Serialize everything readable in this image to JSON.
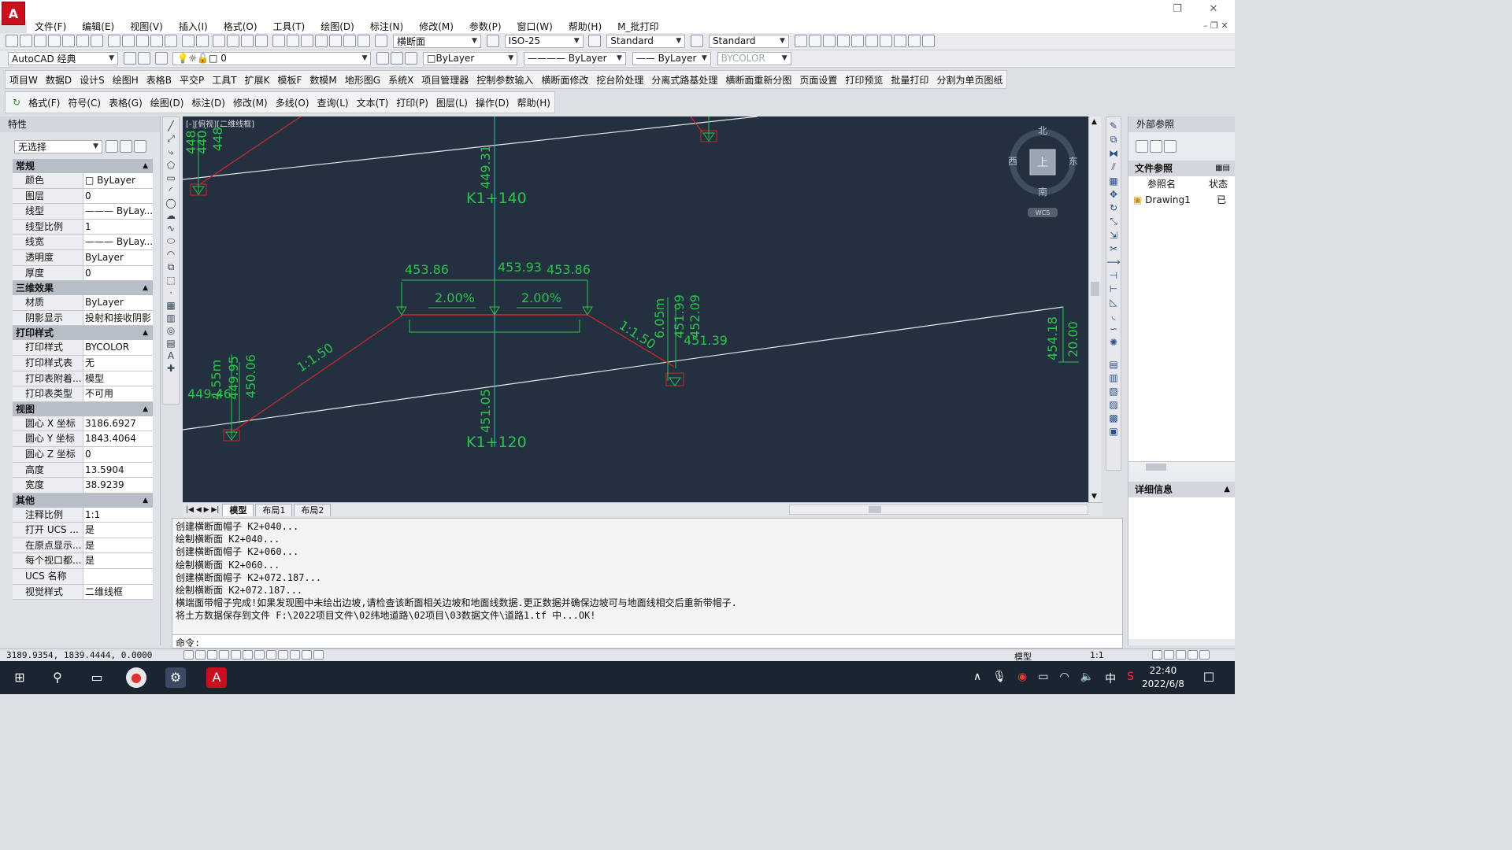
{
  "window": {
    "min_icon": "minimize-icon",
    "restore_icon": "restore-icon",
    "close_icon": "close-icon"
  },
  "menu": [
    "文件(F)",
    "编辑(E)",
    "视图(V)",
    "插入(I)",
    "格式(O)",
    "工具(T)",
    "绘图(D)",
    "标注(N)",
    "修改(M)",
    "参数(P)",
    "窗口(W)",
    "帮助(H)",
    "M_批打印"
  ],
  "toolbar": {
    "text_style": "横断面",
    "dim_style": "ISO-25",
    "table_style": "Standard",
    "multileader_style": "Standard",
    "workspace": "AutoCAD 经典",
    "layer": "0",
    "color": "ByLayer",
    "linetype": "ByLayer",
    "lineweight": "ByLayer",
    "plotstyle": "BYCOLOR"
  },
  "plugin_menu1": [
    "项目W",
    "数据D",
    "设计S",
    "绘图H",
    "表格B",
    "平交P",
    "工具T",
    "扩展K",
    "模板F",
    "数模M",
    "地形图G",
    "系统X",
    "项目管理器",
    "控制参数输入",
    "横断面修改",
    "挖台阶处理",
    "分离式路基处理",
    "横断面重新分图",
    "页面设置",
    "打印预览",
    "批量打印",
    "分割为单页图纸"
  ],
  "plugin_menu2": [
    "格式(F)",
    "符号(C)",
    "表格(G)",
    "绘图(D)",
    "标注(D)",
    "修改(M)",
    "多线(O)",
    "查询(L)",
    "文本(T)",
    "打印(P)",
    "图层(L)",
    "操作(D)",
    "帮助(H)"
  ],
  "properties": {
    "title": "特性",
    "selection": "无选择",
    "sections": [
      {
        "name": "常规",
        "rows": [
          [
            "颜色",
            "□ ByLayer"
          ],
          [
            "图层",
            "0"
          ],
          [
            "线型",
            "——— ByLay..."
          ],
          [
            "线型比例",
            "1"
          ],
          [
            "线宽",
            "——— ByLay..."
          ],
          [
            "透明度",
            "ByLayer"
          ],
          [
            "厚度",
            "0"
          ]
        ]
      },
      {
        "name": "三维效果",
        "rows": [
          [
            "材质",
            "ByLayer"
          ],
          [
            "阴影显示",
            "投射和接收阴影"
          ]
        ]
      },
      {
        "name": "打印样式",
        "rows": [
          [
            "打印样式",
            "BYCOLOR"
          ],
          [
            "打印样式表",
            "无"
          ],
          [
            "打印表附着...",
            "模型"
          ],
          [
            "打印表类型",
            "不可用"
          ]
        ]
      },
      {
        "name": "视图",
        "rows": [
          [
            "圆心 X 坐标",
            "3186.6927"
          ],
          [
            "圆心 Y 坐标",
            "1843.4064"
          ],
          [
            "圆心 Z 坐标",
            "0"
          ],
          [
            "高度",
            "13.5904"
          ],
          [
            "宽度",
            "38.9239"
          ]
        ]
      },
      {
        "name": "其他",
        "rows": [
          [
            "注释比例",
            "1:1"
          ],
          [
            "打开 UCS ...",
            "是"
          ],
          [
            "在原点显示...",
            "是"
          ],
          [
            "每个视口都...",
            "是"
          ],
          [
            "UCS 名称",
            ""
          ],
          [
            "视觉样式",
            "二维线框"
          ]
        ]
      }
    ]
  },
  "viewport_label": "[-][俯视][二维线框]",
  "viewcube": {
    "top": "上",
    "north": "北",
    "south": "南",
    "east": "东",
    "west": "西",
    "wcs": "WCS"
  },
  "drawing": {
    "chainage_top": "K1+140",
    "chainage_bottom": "K1+120",
    "elev_center_top": "449.31",
    "elev_center_bottom": "451.05",
    "elev_left_top_a": "448.",
    "elev_left_top_b": "440.",
    "elev_left_top_c": "448.",
    "elev_left": "453.86",
    "elev_center": "453.93",
    "elev_right": "453.86",
    "slope_left": "2.00%",
    "slope_right": "2.00%",
    "ratio_left": "1:1.50",
    "ratio_right": "1:1.50",
    "ht_right": "6.05m",
    "elev_r1": "451.99",
    "elev_r2": "452.09",
    "elev_r3": "451.39",
    "ht_left": "4.55m",
    "elev_l1": "449.46",
    "elev_l2": "449.95",
    "elev_l3": "450.06",
    "elev_far_right": "454.18",
    "width_far_right": "20.00"
  },
  "layout_tabs": [
    "模型",
    "布局1",
    "布局2"
  ],
  "command_history": [
    "创建横断面帽子 K2+040...",
    "绘制横断面 K2+040...",
    "创建横断面帽子 K2+060...",
    "绘制横断面 K2+060...",
    "创建横断面帽子 K2+072.187...",
    "绘制横断面 K2+072.187...",
    "横端面带帽子完成!如果发现图中未绘出边坡,请检查该断面相关边坡和地面线数据.更正数据并确保边坡可与地面线相交后重新带帽子.",
    "将土方数据保存到文件 F:\\2022项目文件\\02纬地道路\\02项目\\03数据文件\\道路1.tf 中...OK!"
  ],
  "command_prompt": "命令:",
  "status": {
    "coords": "3189.9354, 1839.4444, 0.0000",
    "model": "模型",
    "scale": "1:1"
  },
  "xref": {
    "title": "外部参照",
    "file_refs": "文件参照",
    "col_name": "参照名",
    "col_status": "状态",
    "item": "Drawing1",
    "item_status": "已",
    "details": "详细信息"
  },
  "taskbar": {
    "time": "22:40",
    "date": "2022/6/8",
    "ime": "中"
  }
}
